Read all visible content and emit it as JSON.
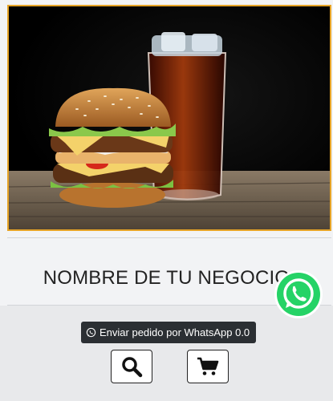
{
  "business": {
    "name": "NOMBRE DE TU NEGOCIO"
  },
  "whatsapp_order": {
    "label": "Enviar pedido por WhatsApp 0.0",
    "icon": "whatsapp-icon"
  },
  "actions": {
    "search_icon": "search-icon",
    "cart_icon": "cart-icon"
  },
  "floating": {
    "icon": "whatsapp-icon",
    "color": "#25d366"
  },
  "colors": {
    "hero_border": "#e6a427",
    "badge_bg": "#2b2f33",
    "page_bg": "#f2f3f5"
  }
}
